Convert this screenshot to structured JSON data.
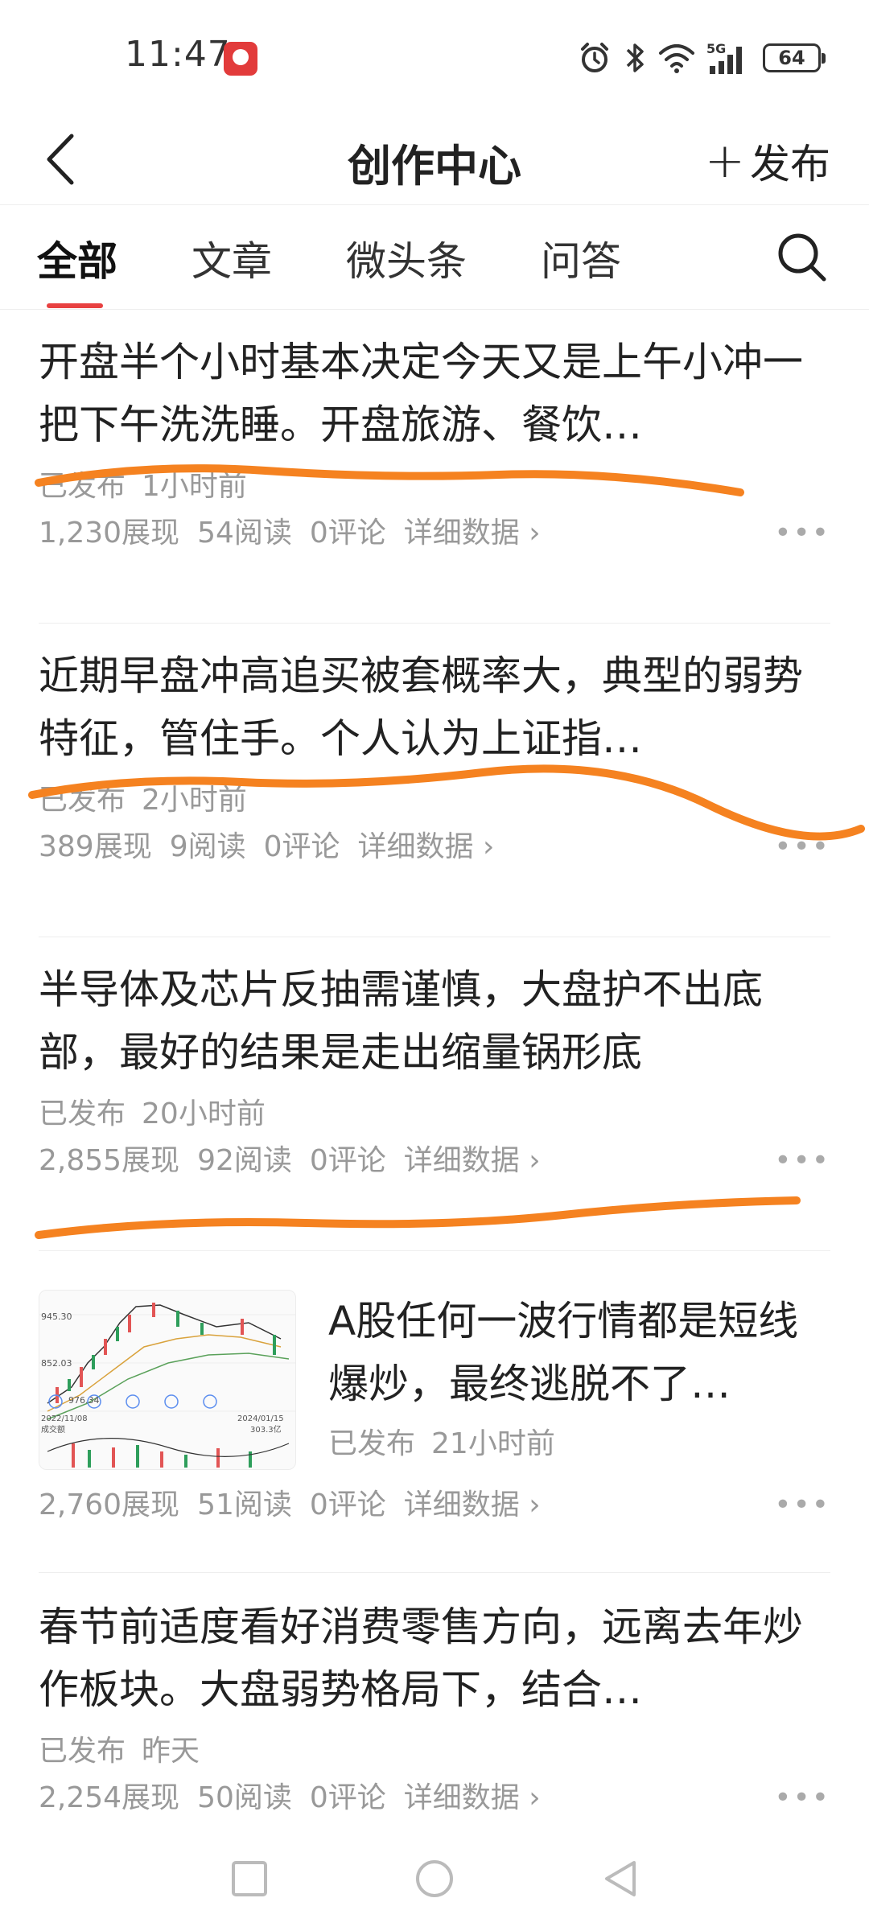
{
  "status": {
    "time": "11:47",
    "battery": "64",
    "network": "5G"
  },
  "header": {
    "title": "创作中心",
    "publish_label": "发布"
  },
  "tabs": [
    {
      "label": "全部",
      "active": true
    },
    {
      "label": "文章"
    },
    {
      "label": "微头条"
    },
    {
      "label": "问答"
    }
  ],
  "items": [
    {
      "title": "开盘半个小时基本决定今天又是上午小冲一把下午洗洗睡。开盘旅游、餐饮…",
      "status": "已发布",
      "time": "1小时前",
      "views": "1,230展现",
      "reads": "54阅读",
      "comments": "0评论",
      "details": "详细数据 ›"
    },
    {
      "title": "近期早盘冲高追买被套概率大，典型的弱势特征，管住手。个人认为上证指…",
      "status": "已发布",
      "time": "2小时前",
      "views": "389展现",
      "reads": "9阅读",
      "comments": "0评论",
      "details": "详细数据 ›"
    },
    {
      "title": "半导体及芯片反抽需谨慎，大盘护不出底部，最好的结果是走出缩量锅形底",
      "status": "已发布",
      "time": "20小时前",
      "views": "2,855展现",
      "reads": "92阅读",
      "comments": "0评论",
      "details": "详细数据 ›"
    },
    {
      "title": "A股任何一波行情都是短线爆炒，最终逃脱不了…",
      "status": "已发布",
      "time": "21小时前",
      "views": "2,760展现",
      "reads": "51阅读",
      "comments": "0评论",
      "details": "详细数据 ›",
      "thumb_labels": {
        "high": "945.30",
        "mid": "852.03",
        "low": "976.34",
        "date_start": "2022/11/08",
        "date_end": "2024/01/15",
        "vol_label": "成交额",
        "vol_value": "303.3亿"
      }
    },
    {
      "title": "春节前适度看好消费零售方向，远离去年炒作板块。大盘弱势格局下，结合…",
      "status": "已发布",
      "time": "昨天",
      "views": "2,254展现",
      "reads": "50阅读",
      "comments": "0评论",
      "details": "详细数据 ›"
    }
  ],
  "more_label": "•••",
  "colors": {
    "accent": "#e84141",
    "highlight": "#f58220"
  }
}
